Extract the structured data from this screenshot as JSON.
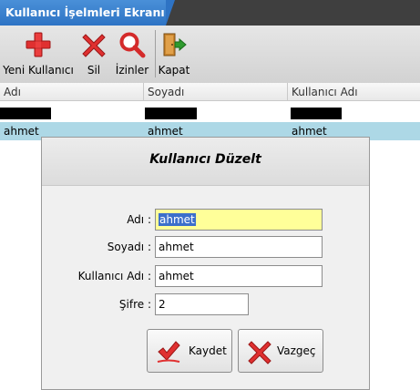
{
  "window": {
    "tab_title": "Kullanıcı İşelmleri Ekranı"
  },
  "toolbar": {
    "new_user": "Yeni Kullanıcı",
    "delete": "Sil",
    "permissions": "İzinler",
    "close": "Kapat"
  },
  "grid": {
    "columns": [
      "Adı",
      "Soyadı",
      "Kullanıcı Adı"
    ],
    "rows": [
      {
        "first_name": "",
        "last_name": "",
        "username": "",
        "redacted": true
      },
      {
        "first_name": "ahmet",
        "last_name": "ahmet",
        "username": "ahmet",
        "selected": true
      }
    ]
  },
  "dialog": {
    "title": "Kullanıcı Düzelt",
    "name_label": "Adı :",
    "name_value": "ahmet",
    "surname_label": "Soyadı :",
    "surname_value": "ahmet",
    "username_label": "Kullanıcı Adı :",
    "username_value": "ahmet",
    "password_label": "Şifre :",
    "password_value": "2",
    "save_label": "Kaydet",
    "cancel_label": "Vazgeç"
  },
  "colors": {
    "tab_blue": "#2e73c4",
    "selected_row": "#add8e6",
    "focused_input": "#ffff99",
    "icon_red": "#e03030",
    "icon_green": "#2e9a2e"
  },
  "icons": {
    "new_user": "plus-icon",
    "delete": "x-icon",
    "permissions": "magnifier-icon",
    "close": "exit-door-icon",
    "save": "checkmark-icon",
    "cancel": "x-icon"
  }
}
